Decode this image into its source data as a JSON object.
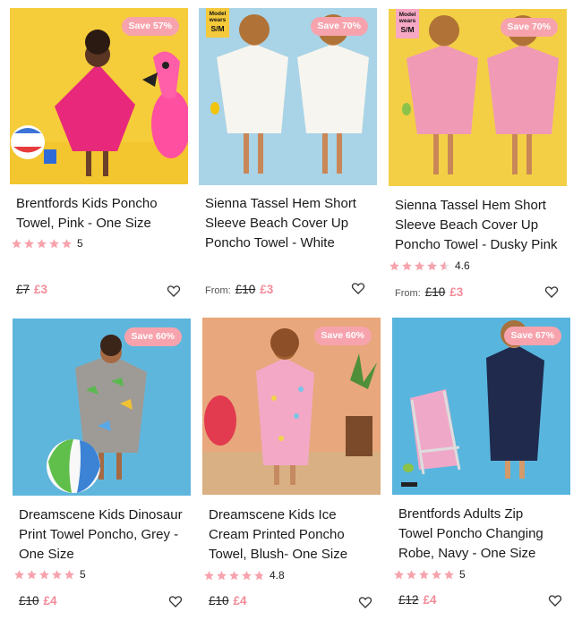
{
  "colors": {
    "badge": "#f7a3ad",
    "sale_price": "#f28b98",
    "star": "#f7a3ad"
  },
  "products": [
    {
      "badge": "Save 57%",
      "title_lines": [
        "Brentfords Kids Poncho",
        "Towel, Pink - One Size"
      ],
      "rating": 5,
      "rating_count": "5",
      "from": "",
      "old_price": "£7",
      "new_price": "£3",
      "model_tag": null
    },
    {
      "badge": "Save 70%",
      "title_lines": [
        "Sienna Tassel Hem Short",
        "Sleeve Beach Cover Up",
        "Poncho Towel - White"
      ],
      "rating": null,
      "rating_count": "",
      "from": "From:",
      "old_price": "£10",
      "new_price": "£3",
      "model_tag": {
        "line1": "Model",
        "line2": "wears",
        "size": "S/M"
      }
    },
    {
      "badge": "Save 70%",
      "title_lines": [
        "Sienna Tassel Hem Short",
        "Sleeve Beach Cover Up",
        "Poncho Towel - Dusky Pink"
      ],
      "rating": 4.6,
      "rating_count": "4.6",
      "from": "From:",
      "old_price": "£10",
      "new_price": "£3",
      "model_tag": {
        "line1": "Model",
        "line2": "wears",
        "size": "S/M"
      }
    },
    {
      "badge": "Save 60%",
      "title_lines": [
        "Dreamscene Kids Dinosaur",
        "Print Towel Poncho, Grey -",
        "One Size"
      ],
      "rating": 5,
      "rating_count": "5",
      "from": "",
      "old_price": "£10",
      "new_price": "£4",
      "model_tag": null
    },
    {
      "badge": "Save 60%",
      "title_lines": [
        "Dreamscene Kids Ice",
        "Cream Printed Poncho",
        "Towel, Blush- One Size"
      ],
      "rating": 4.8,
      "rating_count": "4.8",
      "from": "",
      "old_price": "£10",
      "new_price": "£4",
      "model_tag": null
    },
    {
      "badge": "Save 67%",
      "title_lines": [
        "Brentfords Adults Zip",
        "Towel Poncho Changing",
        "Robe, Navy - One Size"
      ],
      "rating": 5,
      "rating_count": "5",
      "from": "",
      "old_price": "£12",
      "new_price": "£4",
      "model_tag": null
    }
  ]
}
